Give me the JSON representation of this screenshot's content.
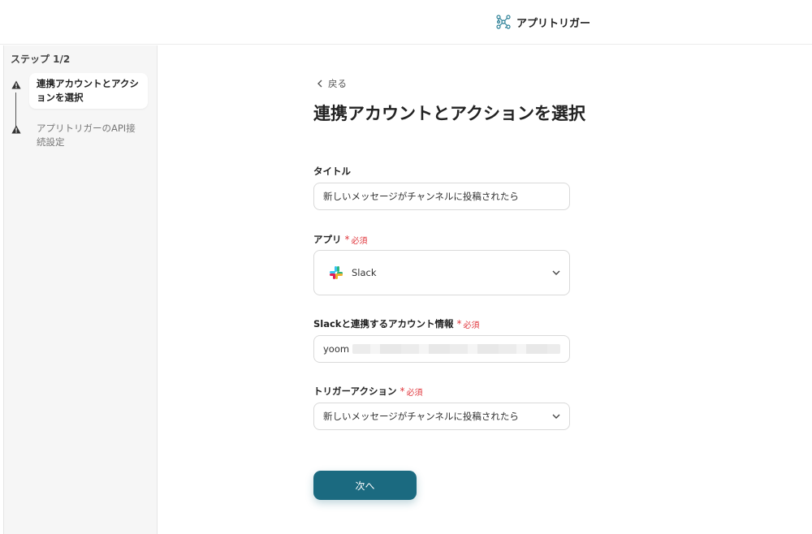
{
  "header": {
    "brand_name": "アプリトリガー",
    "brand_icon": "network-nodes-icon"
  },
  "sidebar": {
    "step_count": "ステップ 1/2",
    "steps": [
      {
        "label": "連携アカウントとアクションを選択",
        "status": "active",
        "icon": "warning-icon"
      },
      {
        "label": "アプリトリガーのAPI接続設定",
        "status": "inactive",
        "icon": "warning-icon"
      }
    ]
  },
  "main": {
    "back_label": "戻る",
    "title": "連携アカウントとアクションを選択",
    "required_label": "必須",
    "fields": {
      "title": {
        "label": "タイトル",
        "value": "新しいメッセージがチャンネルに投稿されたら"
      },
      "app": {
        "label": "アプリ",
        "value": "Slack",
        "icon": "slack-logo-icon"
      },
      "account": {
        "label": "Slackと連携するアカウント情報",
        "value": "yoom"
      },
      "trigger_action": {
        "label": "トリガーアクション",
        "value": "新しいメッセージがチャンネルに投稿されたら"
      }
    },
    "next_label": "次へ"
  },
  "colors": {
    "accent": "#1b6a80",
    "required": "#e0363c"
  }
}
